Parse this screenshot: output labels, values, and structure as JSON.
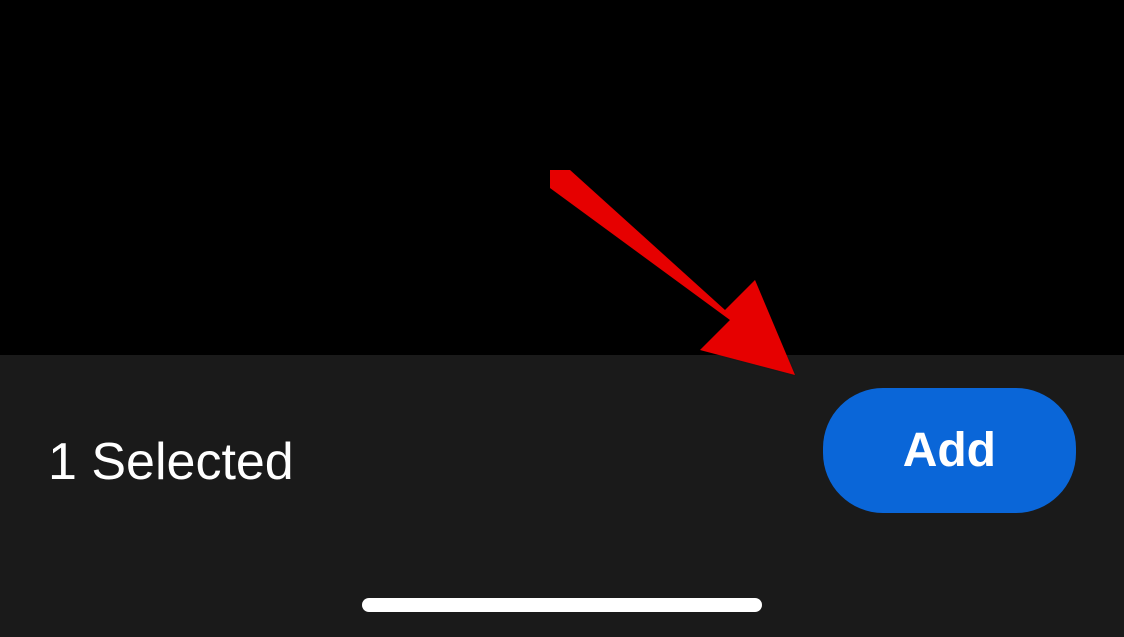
{
  "toolbar": {
    "selected_label": "1 Selected",
    "add_button_label": "Add"
  },
  "colors": {
    "accent": "#0a66d8",
    "annotation": "#e60000"
  }
}
